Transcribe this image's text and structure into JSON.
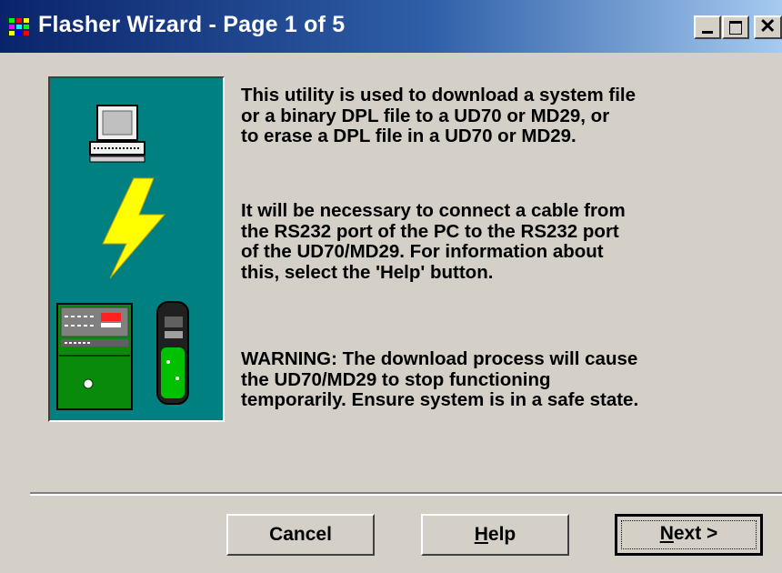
{
  "window": {
    "title": "Flasher Wizard - Page 1 of 5",
    "controls": {
      "minimize_icon": "minimize-icon",
      "maximize_icon": "maximize-icon",
      "close_icon": "close-icon"
    }
  },
  "content": {
    "paragraph1": [
      "This utility is used to download a system file",
      "or a binary DPL file to a UD70 or MD29, or",
      "to erase a DPL file in a UD70 or MD29."
    ],
    "paragraph2": [
      "It will be necessary to connect a cable from",
      "the RS232 port of the PC to the RS232 port",
      "of the UD70/MD29. For information about",
      "this, select the 'Help' button."
    ],
    "paragraph3": [
      "WARNING: The download process will cause",
      "the UD70/MD29 to stop functioning",
      "temporarily. Ensure system is in a safe state."
    ]
  },
  "buttons": {
    "cancel": "Cancel",
    "help": {
      "mnemonic": "H",
      "rest": "elp"
    },
    "next": {
      "mnemonic": "N",
      "rest": "ext >"
    }
  },
  "colors": {
    "title_gradient_start": "#0a246a",
    "title_gradient_end": "#a6caf0",
    "illustration_bg": "#008080",
    "dialog_face": "#d4d0c8",
    "lightning": "#ffff00",
    "drive_green": "#00a000"
  },
  "illustration_icons": [
    "computer-icon",
    "lightning-bolt-icon",
    "drive-unit-icon",
    "drive-module-icon"
  ]
}
